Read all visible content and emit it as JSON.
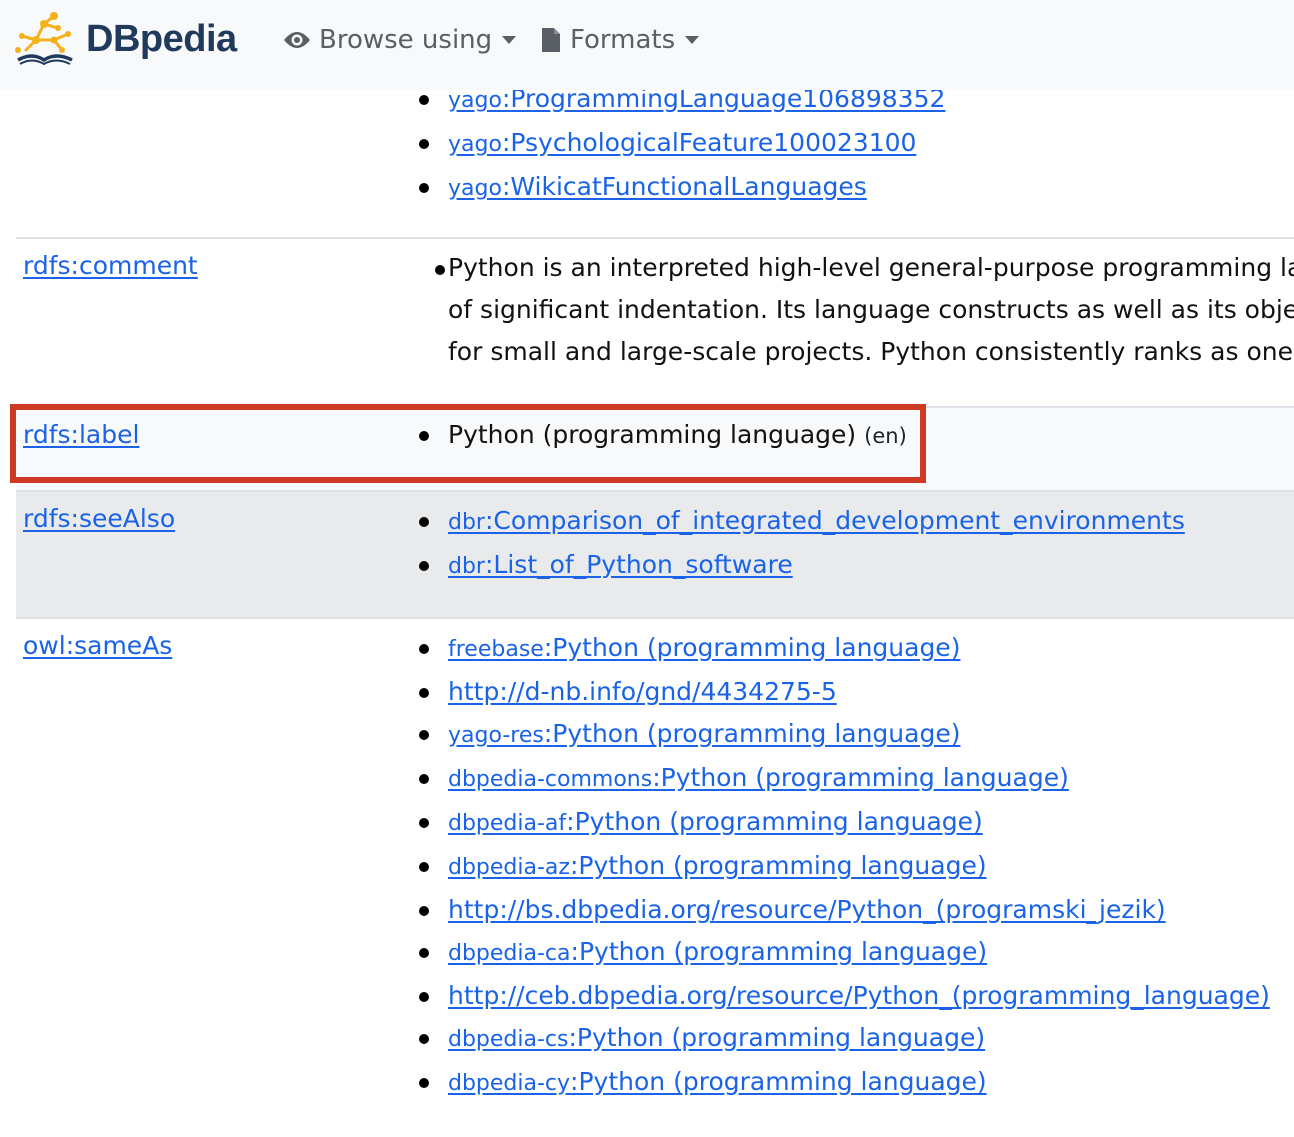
{
  "navbar": {
    "brand": "DBpedia",
    "browse_using_label": "Browse using",
    "formats_label": "Formats",
    "icons": {
      "browse": "eye-icon",
      "formats": "file-icon"
    }
  },
  "rows": {
    "type": {
      "values": [
        {
          "prefix": "yago",
          "local": "ProgrammingLanguage106898352"
        },
        {
          "prefix": "yago",
          "local": "PsychologicalFeature100023100"
        },
        {
          "prefix": "yago",
          "local": "WikicatFunctionalLanguages"
        }
      ]
    },
    "comment": {
      "property": "rdfs:comment",
      "lines": [
        "Python is an interpreted high-level general-purpose programming la",
        "of significant indentation. Its language constructs as well as its obje",
        "for small and large-scale projects. Python consistently ranks as one"
      ]
    },
    "label": {
      "property": "rdfs:label",
      "value": "Python (programming language)",
      "lang": "(en)"
    },
    "seeAlso": {
      "property": "rdfs:seeAlso",
      "values": [
        {
          "prefix": "dbr",
          "local": "Comparison_of_integrated_development_environments"
        },
        {
          "prefix": "dbr",
          "local": "List_of_Python_software"
        }
      ]
    },
    "sameAs": {
      "property": "owl:sameAs",
      "values": [
        {
          "prefix": "freebase",
          "local": "Python (programming language)"
        },
        {
          "prefix": "",
          "local": "http://d-nb.info/gnd/4434275-5"
        },
        {
          "prefix": "yago-res",
          "local": "Python (programming language)"
        },
        {
          "prefix": "dbpedia-commons",
          "local": "Python (programming language)"
        },
        {
          "prefix": "dbpedia-af",
          "local": "Python (programming language)"
        },
        {
          "prefix": "dbpedia-az",
          "local": "Python (programming language)"
        },
        {
          "prefix": "",
          "local": "http://bs.dbpedia.org/resource/Python_(programski_jezik)"
        },
        {
          "prefix": "dbpedia-ca",
          "local": "Python (programming language)"
        },
        {
          "prefix": "",
          "local": "http://ceb.dbpedia.org/resource/Python_(programming_language)"
        },
        {
          "prefix": "dbpedia-cs",
          "local": "Python (programming language)"
        },
        {
          "prefix": "dbpedia-cy",
          "local": "Python (programming language)"
        }
      ]
    }
  },
  "colors": {
    "link": "#1a63e8",
    "highlight_border": "#cc3a24",
    "shaded_row": "#e9eaec",
    "navbar_bg": "#f8f9fa"
  }
}
